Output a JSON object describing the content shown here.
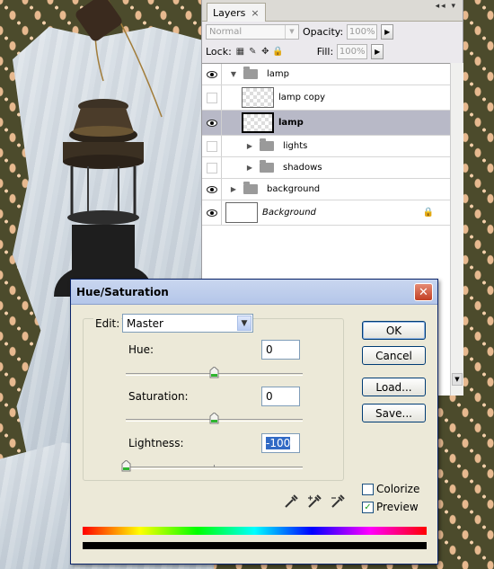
{
  "layers_panel": {
    "tab_label": "Layers",
    "tab_close": "×",
    "panel_controls": "◂◂ ▾",
    "blend_mode": "Normal",
    "opacity_label": "Opacity:",
    "opacity_value": "100%",
    "lock_label": "Lock:",
    "fill_label": "Fill:",
    "fill_value": "100%",
    "layers": [
      {
        "name": "lamp",
        "type": "group",
        "visible": true,
        "expanded": true,
        "indent": 0
      },
      {
        "name": "lamp copy",
        "type": "layer",
        "visible": false,
        "indent": 1
      },
      {
        "name": "lamp",
        "type": "layer",
        "visible": true,
        "selected": true,
        "indent": 1
      },
      {
        "name": "lights",
        "type": "group",
        "visible": false,
        "expanded": false,
        "indent": 1
      },
      {
        "name": "shadows",
        "type": "group",
        "visible": false,
        "expanded": false,
        "indent": 1
      },
      {
        "name": "background",
        "type": "group",
        "visible": true,
        "expanded": false,
        "indent": 0
      },
      {
        "name": "Background",
        "type": "layer",
        "visible": true,
        "locked": true,
        "indent": 0
      }
    ]
  },
  "dialog": {
    "title": "Hue/Saturation",
    "edit_label": "Edit:",
    "edit_value": "Master",
    "hue_label": "Hue:",
    "hue_value": "0",
    "saturation_label": "Saturation:",
    "saturation_value": "0",
    "lightness_label": "Lightness:",
    "lightness_value": "-100",
    "ok_label": "OK",
    "cancel_label": "Cancel",
    "load_label": "Load...",
    "save_label": "Save...",
    "colorize_label": "Colorize",
    "preview_label": "Preview",
    "colorize_checked": false,
    "preview_checked": true,
    "hue_slider_fraction": 0.5,
    "saturation_slider_fraction": 0.5,
    "lightness_slider_fraction": 0.0
  },
  "colors": {
    "dialog_bg": "#ece9d8",
    "title_bar": "#b4c6e9",
    "selected_layer": "#b8b9c7",
    "damask_dark": "#4c4b2c",
    "damask_light": "#e7b98f"
  }
}
